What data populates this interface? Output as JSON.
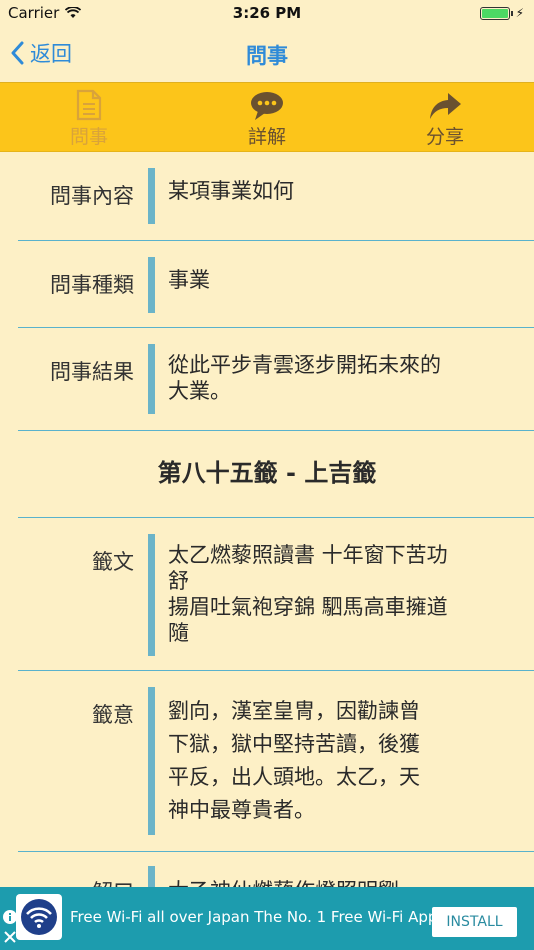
{
  "status_bar": {
    "carrier": "Carrier",
    "time": "3:26 PM"
  },
  "nav": {
    "back_label": "返回",
    "title": "問事"
  },
  "toolbar": {
    "items": [
      {
        "label": "問事",
        "icon": "document-icon"
      },
      {
        "label": "詳解",
        "icon": "chat-bubble-icon"
      },
      {
        "label": "分享",
        "icon": "share-arrow-icon"
      }
    ]
  },
  "details": {
    "content_label": "問事內容",
    "content_value": "某項事業如何",
    "type_label": "問事種類",
    "type_value": "事業",
    "result_label": "問事結果",
    "result_value": "從此平步青雲逐步開拓未來的\n大業。",
    "sign_title": "第八十五籤 - 上吉籤",
    "poem_label": "籤文",
    "poem_value": "太乙燃藜照讀書 十年窗下苦功\n舒\n揚眉吐氣袍穿錦 駟馬高車擁道\n隨",
    "meaning_label": "籤意",
    "meaning_value": "劉向，漢室皇冑，因勸諫曾\n下獄，獄中堅持苦讀，後獲\n平反，出人頭地。太乙，天\n神中最尊貴者。",
    "explain_label": "解曰",
    "explain_value": "太乙神仙燃藜作燈照明劉"
  },
  "ad": {
    "text": "Free Wi-Fi all over Japan The No. 1 Free Wi-Fi App",
    "button_label": "INSTALL"
  },
  "colors": {
    "background": "#fdf0c6",
    "toolbar": "#fcc51a",
    "accent_blue": "#2f8bd8",
    "divider": "#59b2cc",
    "ad_background": "#1d9cae"
  }
}
